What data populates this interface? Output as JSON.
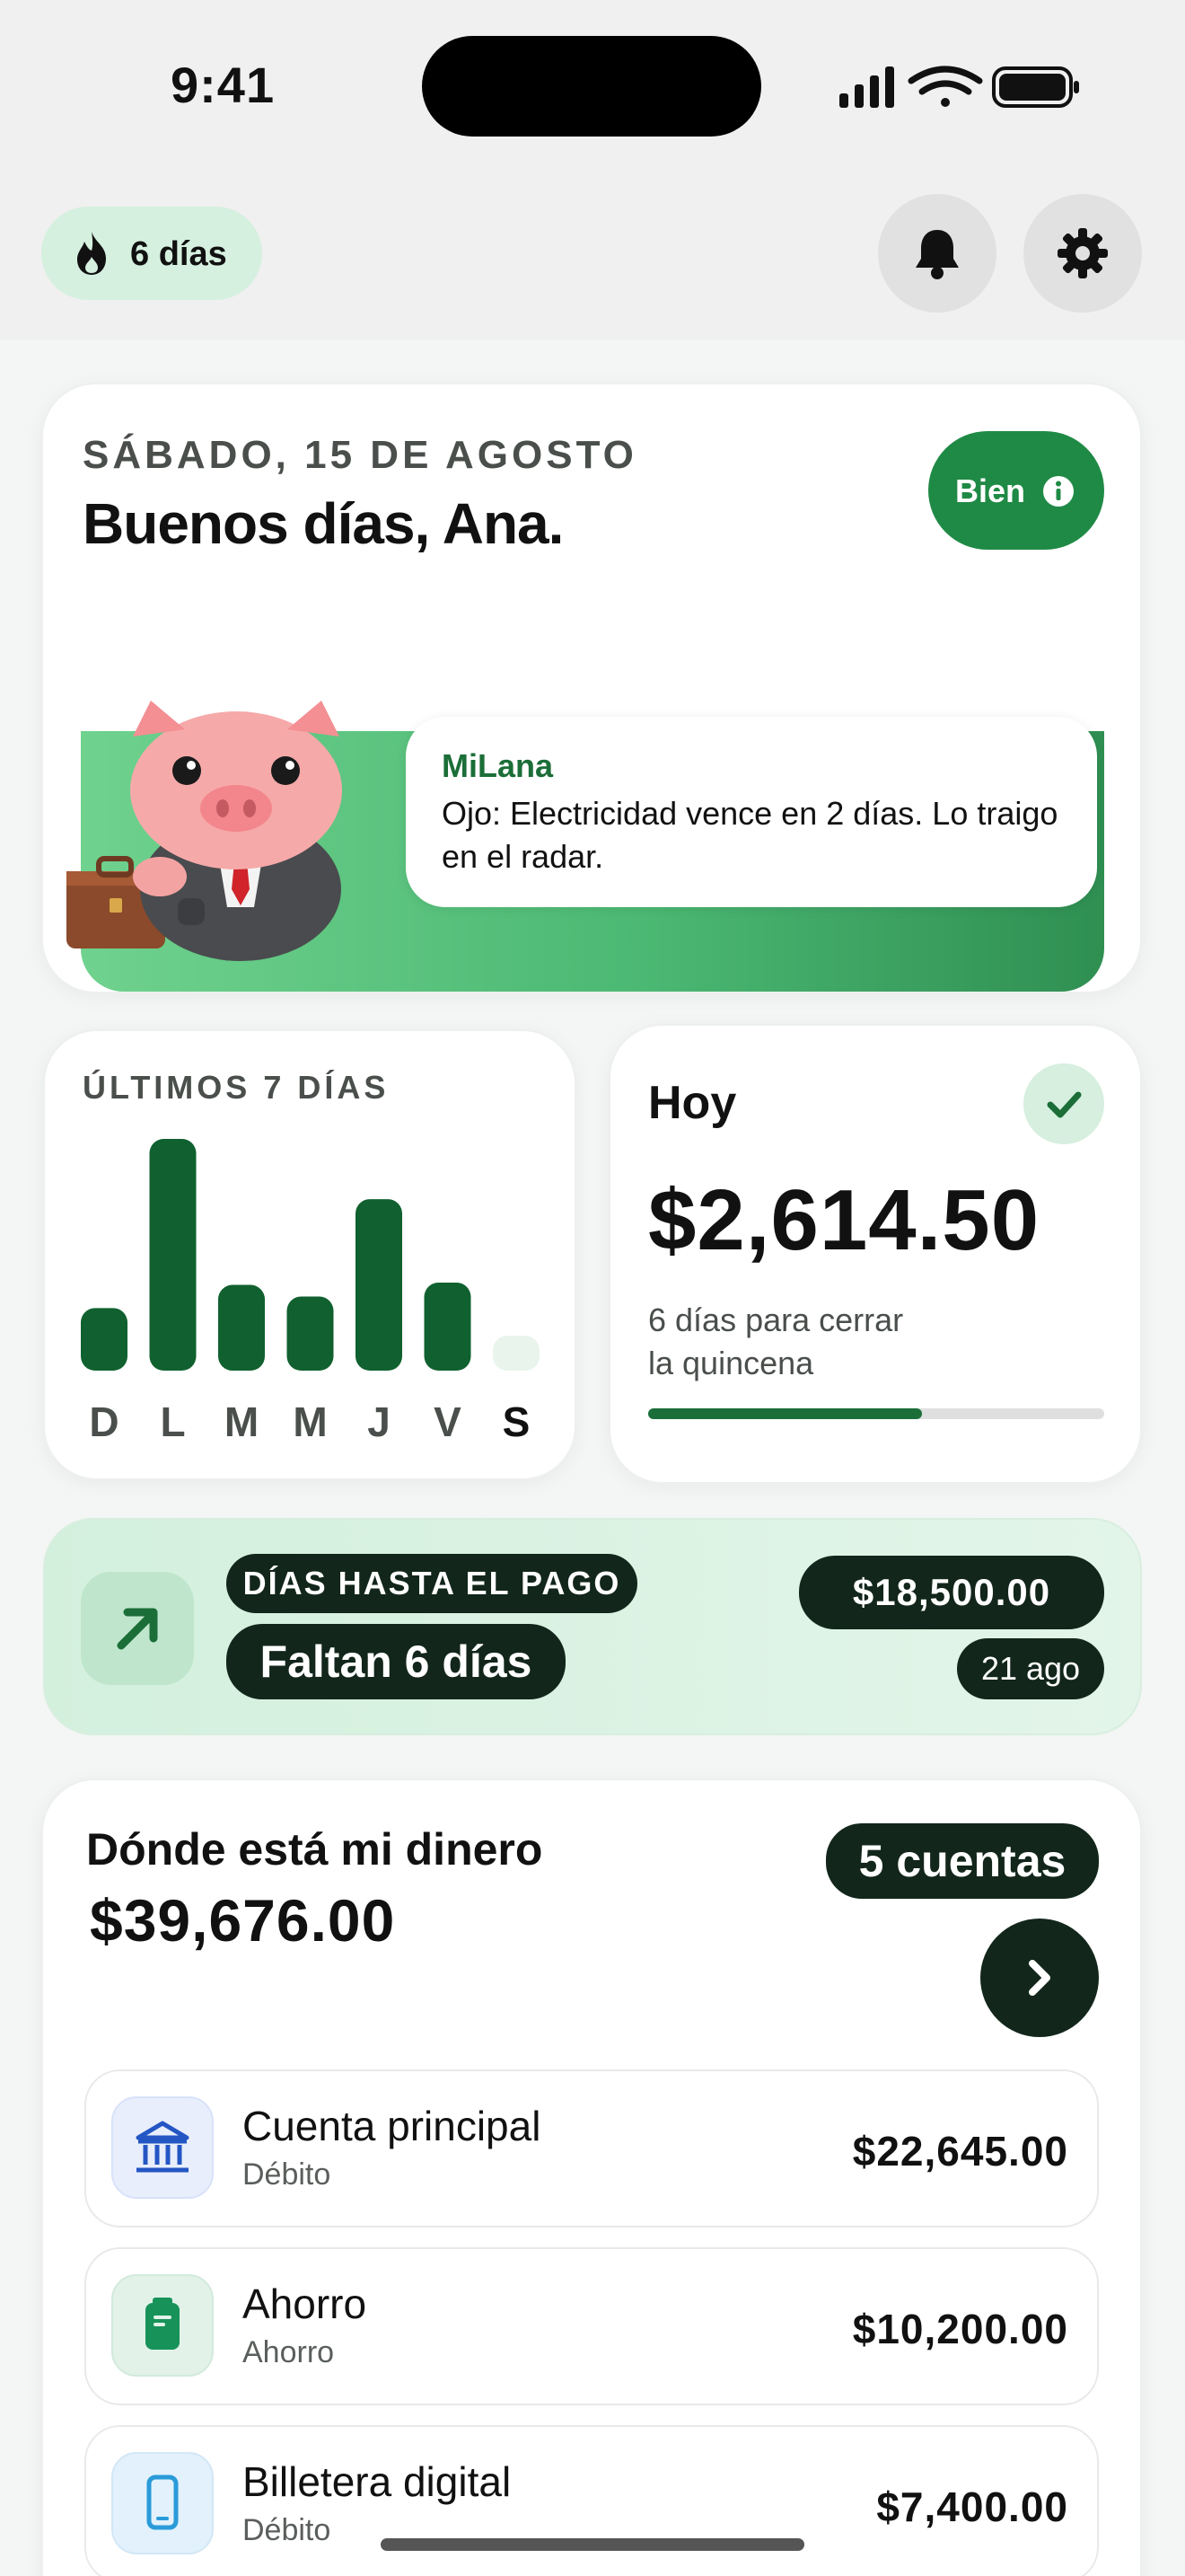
{
  "status_bar": {
    "time": "9:41"
  },
  "header": {
    "streak_label": "6 días",
    "icons": [
      "flame-icon",
      "bell-icon",
      "gear-icon"
    ]
  },
  "greeting_card": {
    "date": "SÁBADO, 15 DE AGOSTO",
    "greeting": "Buenos días, Ana.",
    "status_label": "Bien",
    "assistant_name": "MiLana",
    "assistant_message": "Ojo: Electricidad vence en 2 días. Lo traigo en el radar."
  },
  "week_card": {
    "title": "ÚLTIMOS 7 DÍAS",
    "chart_data": {
      "type": "bar",
      "categories": [
        "D",
        "L",
        "M",
        "M",
        "J",
        "V",
        "S"
      ],
      "values": [
        27,
        100,
        37,
        32,
        74,
        38,
        15
      ],
      "today_index": 6,
      "bar_color": "#10612f",
      "empty_color": "#e8f4ec"
    }
  },
  "today_card": {
    "title": "Hoy",
    "amount": "$2,614.50",
    "subtitle_line1": "6 días para cerrar",
    "subtitle_line2": "la quincena",
    "progress": 0.6
  },
  "payday_card": {
    "label": "DÍAS HASTA EL PAGO",
    "days_left": "Faltan 6 días",
    "amount": "$18,500.00",
    "date": "21 ago"
  },
  "money_card": {
    "title": "Dónde está mi dinero",
    "total": "$39,676.00",
    "accounts_count": "5 cuentas",
    "accounts": [
      {
        "name": "Cuenta principal",
        "type": "Débito",
        "amount": "$22,645.00",
        "icon": "bank-icon",
        "icon_bg": "#e8eefc",
        "icon_color": "#2456c4"
      },
      {
        "name": "Ahorro",
        "type": "Ahorro",
        "amount": "$10,200.00",
        "icon": "savings-jar-icon",
        "icon_bg": "#e2f2e8",
        "icon_color": "#17935a"
      },
      {
        "name": "Billetera digital",
        "type": "Débito",
        "amount": "$7,400.00",
        "icon": "phone-wallet-icon",
        "icon_bg": "#e2f1fb",
        "icon_color": "#2a9bd9"
      }
    ]
  },
  "colors": {
    "brand_green": "#1f8a45",
    "dark_green": "#12261b",
    "accent_light": "#d5f0df"
  }
}
